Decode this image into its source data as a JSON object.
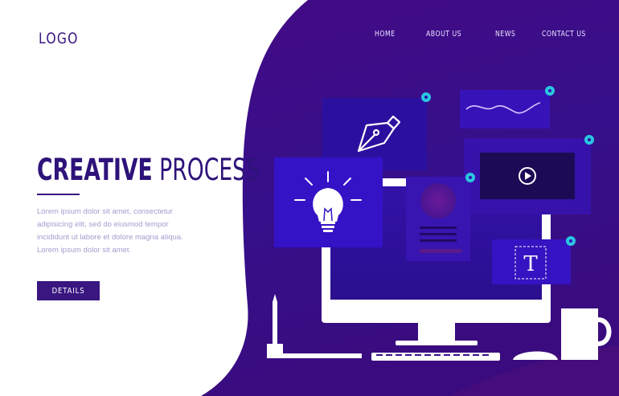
{
  "header": {
    "logo": "LOGO",
    "nav": [
      {
        "label": "HOME"
      },
      {
        "label": "ABOUT US"
      },
      {
        "label": "NEWS"
      },
      {
        "label": "CONTACT US"
      }
    ]
  },
  "hero": {
    "title_strong": "CREATIVE",
    "title_light": " PROCESS",
    "description": "Lorem ipsum dolor sit amet, consectetur adipisicing elit, sed do eiusmod tempor incididunt ut labore et dolore magna aliqua. Lorem ipsum dolor sit amet.",
    "button_label": "DETAILS"
  },
  "illustration": {
    "text_tool_glyph": "T",
    "icons": [
      "pen-nib-icon",
      "lightbulb-icon",
      "play-icon",
      "text-tool-icon",
      "pencil-icon",
      "mug-icon",
      "keyboard-icon",
      "mouse-icon",
      "monitor-icon"
    ]
  },
  "colors": {
    "brand_dark": "#3a1680",
    "panel_bg": "#3a0f86",
    "card_blue": "#3312b8",
    "accent_cyan": "#29c7e0",
    "text_muted": "#a79bcf"
  }
}
